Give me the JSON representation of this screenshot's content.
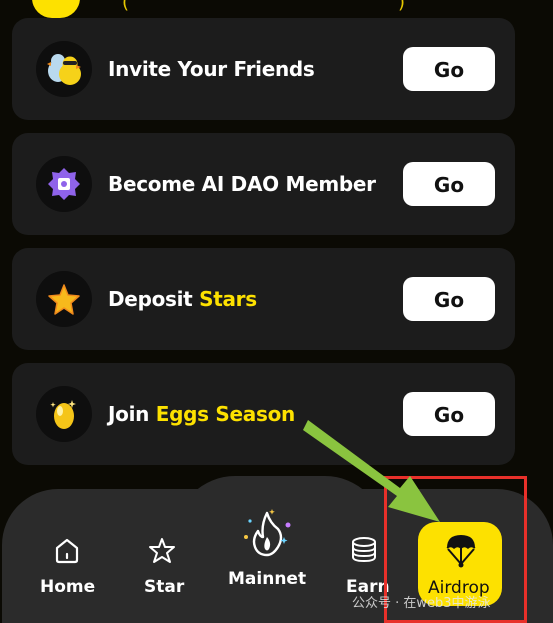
{
  "colors": {
    "accent": "#fde100",
    "card": "#1c1c1c",
    "nav": "#2b2b2b",
    "highlight": "#e8302a",
    "arrow": "#8ac43f"
  },
  "tasks": [
    {
      "title": "Invite Your Friends",
      "accent": "",
      "icon": "chicks-icon",
      "action": "Go"
    },
    {
      "title": "Become AI DAO Member",
      "accent": "",
      "icon": "dao-badge-icon",
      "action": "Go"
    },
    {
      "title": "Deposit ",
      "accent": "Stars",
      "icon": "star-icon",
      "action": "Go"
    },
    {
      "title": "Join ",
      "accent": "Eggs Season",
      "icon": "golden-egg-icon",
      "action": "Go"
    }
  ],
  "nav": {
    "items": [
      {
        "label": "Home",
        "icon": "home-icon"
      },
      {
        "label": "Star",
        "icon": "star-outline-icon"
      },
      {
        "label": "Mainnet",
        "icon": "flame-icon"
      },
      {
        "label": "Earn",
        "icon": "coins-icon"
      },
      {
        "label": "Airdrop",
        "icon": "parachute-icon",
        "active": true
      }
    ]
  },
  "watermark": "公众号 · 在web3中游泳"
}
